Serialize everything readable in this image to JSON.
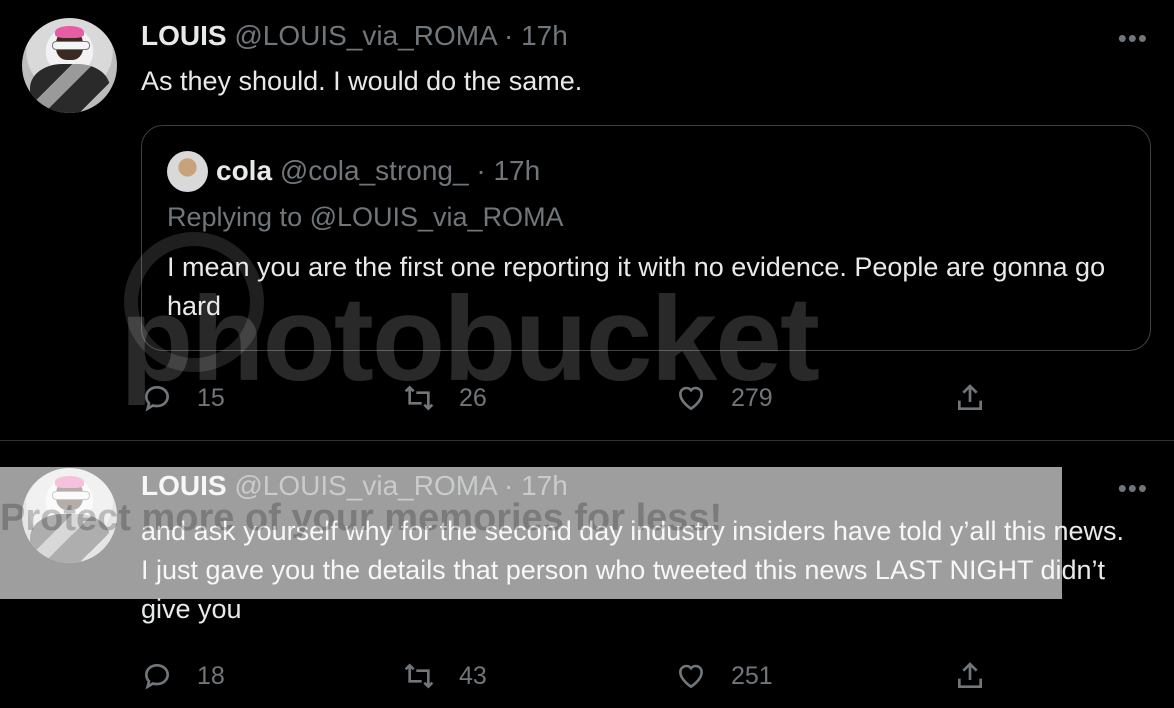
{
  "tweets": [
    {
      "name": "LOUIS",
      "handle": "@LOUIS_via_ROMA",
      "separator": "·",
      "time": "17h",
      "more": "•••",
      "text": "As they should. I would do the same.",
      "quote": {
        "name": "cola",
        "handle": "@cola_strong_",
        "separator": "·",
        "time": "17h",
        "replying": "Replying to @LOUIS_via_ROMA",
        "text": "I mean you are the first one reporting it with no evidence. People are gonna go hard"
      },
      "actions": {
        "replies": "15",
        "retweets": "26",
        "likes": "279"
      }
    },
    {
      "name": "LOUIS",
      "handle": "@LOUIS_via_ROMA",
      "separator": "·",
      "time": "17h",
      "more": "•••",
      "text": "and ask yourself why for the second day industry insiders have told y’all this news. I just gave you the details that person who tweeted this news LAST NIGHT didn’t give you",
      "actions": {
        "replies": "18",
        "retweets": "43",
        "likes": "251"
      }
    }
  ],
  "watermark": {
    "logo_text": "photobucket",
    "banner_text": "Protect more of your memories for less!"
  },
  "icons": [
    "reply-icon",
    "retweet-icon",
    "like-icon",
    "share-icon",
    "more-icon"
  ],
  "colors": {
    "background": "#000000",
    "text": "#e7e9ea",
    "secondary": "#71767b",
    "border": "#3e4144"
  }
}
